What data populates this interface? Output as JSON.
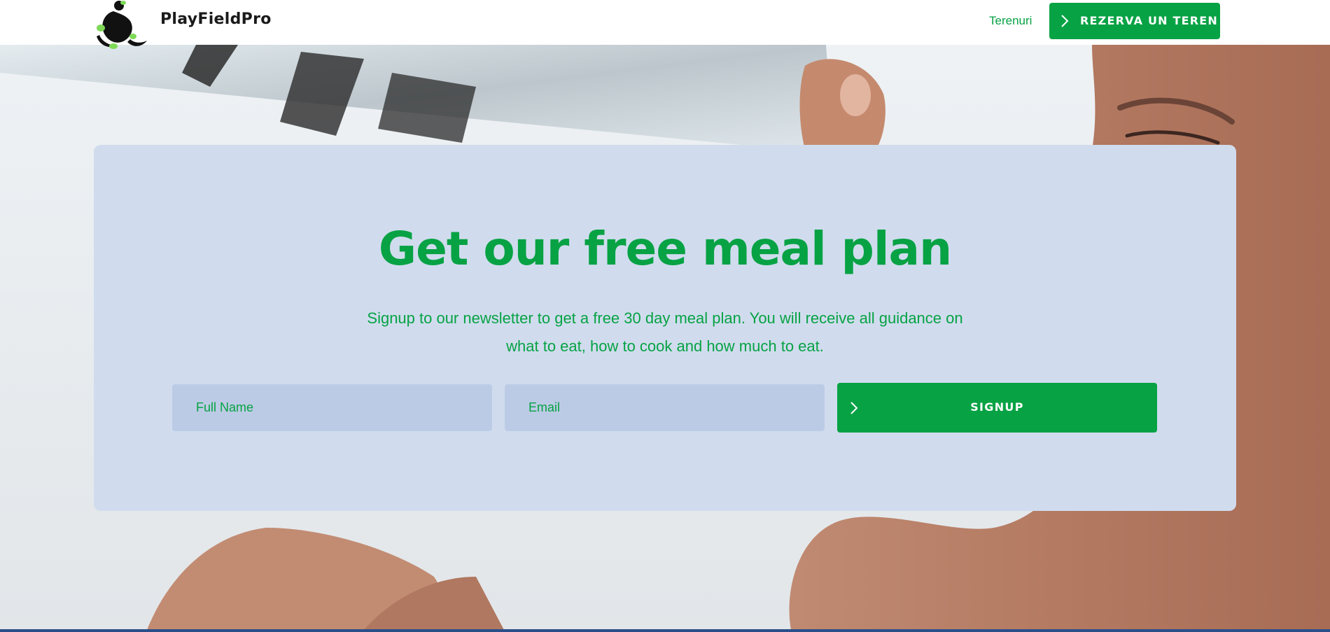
{
  "header": {
    "brand": "PlayFieldPro",
    "nav_link": "Terenuri",
    "cta_label": "REZERVA UN TEREN",
    "logo_icon": "playfieldpro-logo",
    "cta_icon": "chevron-right-icon"
  },
  "hero": {
    "title": "Get our free meal plan",
    "description": "Signup to our newsletter to get a free 30 day meal plan. You will receive all guidance on what to eat, how to cook and how much to eat.",
    "form": {
      "name_placeholder": "Full Name",
      "email_placeholder": "Email",
      "submit_label": "SIGNUP",
      "submit_icon": "chevron-right-icon"
    }
  },
  "colors": {
    "brand_green": "#07a244",
    "card_background": "#d0dcee",
    "input_background": "#bccbe5"
  }
}
